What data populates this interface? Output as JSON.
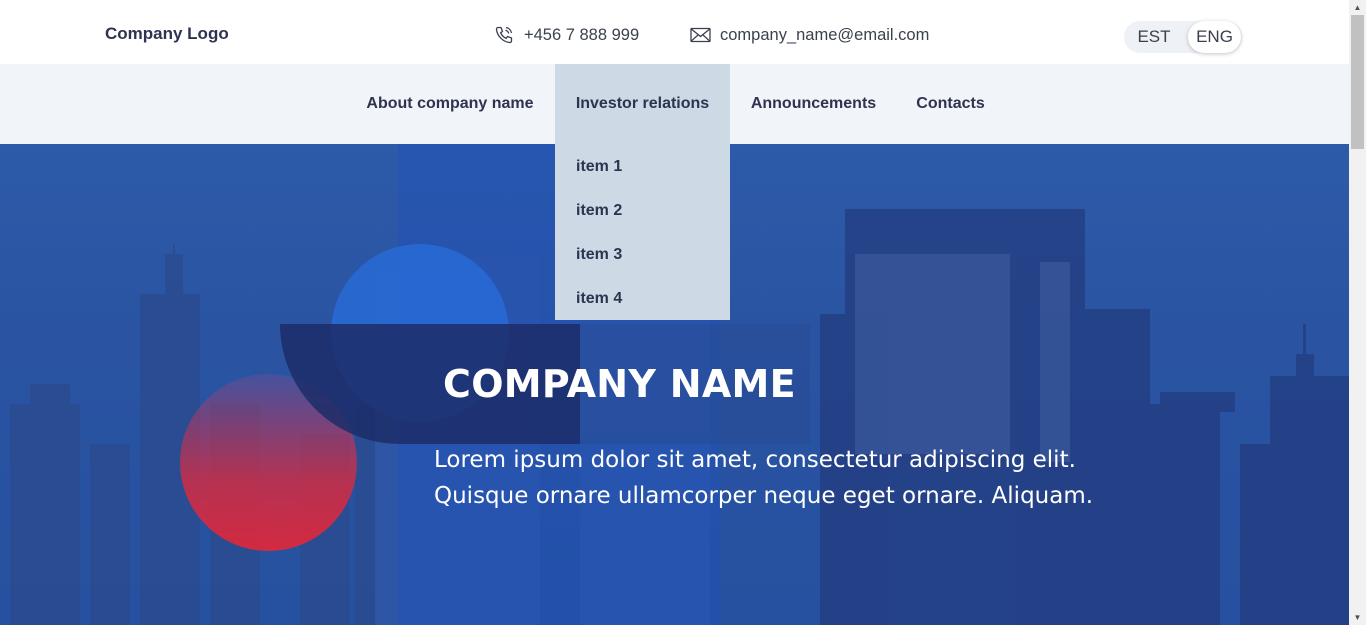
{
  "header": {
    "logo": "Company Logo",
    "phone": "+456 7 888 999",
    "email": "company_name@email.com",
    "phone_icon": "phone-icon",
    "email_icon": "envelope-icon",
    "languages": [
      "EST",
      "ENG"
    ],
    "active_language": "ENG"
  },
  "nav": {
    "items": [
      {
        "label": "About company name"
      },
      {
        "label": "Investor relations"
      },
      {
        "label": "Announcements"
      },
      {
        "label": "Contacts"
      }
    ],
    "active": "Investor relations",
    "dropdown": [
      "item 1",
      "item 2",
      "item 3",
      "item 4"
    ]
  },
  "hero": {
    "title": "COMPANY NAME",
    "text_line1": "Lorem ipsum dolor sit amet, consectetur adipiscing elit.",
    "text_line2": "Quisque ornare ullamcorper neque eget ornare. Aliquam."
  },
  "colors": {
    "text_dark": "#2e3350",
    "nav_bg": "#f1f4f8",
    "nav_active_bg": "#ced9e6",
    "hero_blue": "#2a54a2",
    "accent_red": "#dc283c"
  }
}
